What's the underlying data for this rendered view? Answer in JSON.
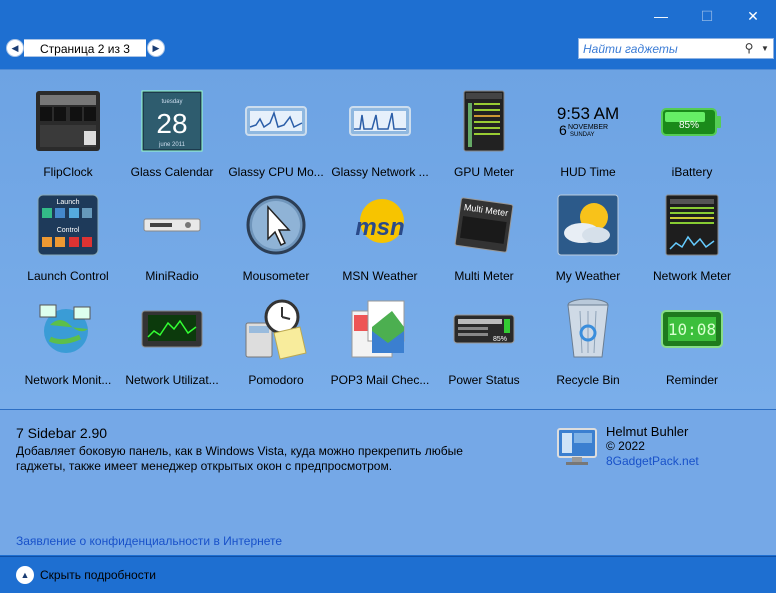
{
  "window": {
    "minimize_icon": "—",
    "maximize_icon": "☐",
    "close_icon": "✕"
  },
  "nav": {
    "page_label": "Страница 2 из 3",
    "prev_icon": "◀",
    "next_icon": "▶"
  },
  "search": {
    "placeholder": "Найти гаджеты",
    "icon": "⚲",
    "dropdown_icon": "▼"
  },
  "gadgets": [
    {
      "label": "FlipClock",
      "icon": "flipclock-icon"
    },
    {
      "label": "Glass Calendar",
      "icon": "calendar-icon",
      "day": "28",
      "top": "tuesday",
      "bottom": "june 2011"
    },
    {
      "label": "Glassy CPU Mo...",
      "icon": "cpu-monitor-icon"
    },
    {
      "label": "Glassy Network ...",
      "icon": "network-monitor-icon"
    },
    {
      "label": "GPU Meter",
      "icon": "gpu-meter-icon"
    },
    {
      "label": "HUD Time",
      "icon": "hud-time-icon",
      "time": "9:53 AM",
      "date_num": "6",
      "month": "NOVEMBER",
      "weekday": "SUNDAY"
    },
    {
      "label": "iBattery",
      "icon": "battery-icon",
      "percent": "85%"
    },
    {
      "label": "Launch Control",
      "icon": "launch-control-icon",
      "top": "Launch",
      "bottom": "Control"
    },
    {
      "label": "MiniRadio",
      "icon": "radio-icon"
    },
    {
      "label": "Mousometer",
      "icon": "mouse-pointer-icon"
    },
    {
      "label": "MSN Weather",
      "icon": "msn-logo-icon",
      "logo": "msn"
    },
    {
      "label": "Multi Meter",
      "icon": "multi-meter-icon",
      "title": "Multi Meter"
    },
    {
      "label": "My Weather",
      "icon": "weather-icon"
    },
    {
      "label": "Network Meter",
      "icon": "network-meter-icon"
    },
    {
      "label": "Network Monit...",
      "icon": "globe-network-icon"
    },
    {
      "label": "Network Utilizat...",
      "icon": "network-utilization-icon"
    },
    {
      "label": "Pomodoro",
      "icon": "clock-calculator-icon"
    },
    {
      "label": "POP3 Mail Chec...",
      "icon": "mail-icon"
    },
    {
      "label": "Power Status",
      "icon": "power-status-icon",
      "value": "85%"
    },
    {
      "label": "Recycle Bin",
      "icon": "recycle-bin-icon"
    },
    {
      "label": "Reminder",
      "icon": "reminder-icon",
      "display": "10:08"
    }
  ],
  "details": {
    "title": "7 Sidebar 2.90",
    "description": "Добавляет боковую панель, как в Windows Vista, куда можно прекрепить любые гаджеты, также имеет менеджер открытых окон с предпросмотром.",
    "author": "Helmut Buhler",
    "copyright": "© 2022",
    "link": "8GadgetPack.net",
    "privacy": "Заявление о конфиденциальности в Интернете"
  },
  "footer": {
    "hide_label": "Скрыть подробности",
    "up_icon": "▲"
  },
  "colors": {
    "window_bg": "#1e6fd1",
    "panel_bg": "#6da3e3",
    "link": "#1851c9"
  }
}
